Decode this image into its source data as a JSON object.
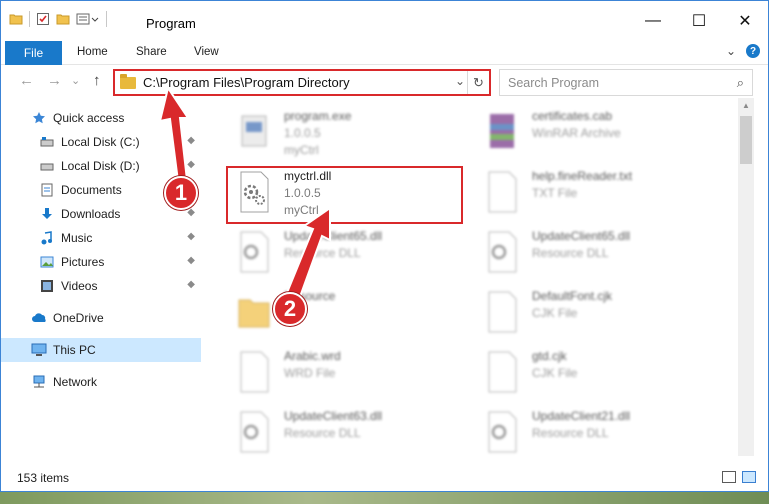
{
  "window": {
    "title": "Program",
    "controls": {
      "minimize": "—",
      "maximize": "☐",
      "close": "✕"
    }
  },
  "ribbon": {
    "tabs": [
      "File",
      "Home",
      "Share",
      "View"
    ],
    "expand": "⌄",
    "help": "?"
  },
  "nav": {
    "back": "←",
    "forward": "→",
    "recent": "⌄",
    "up": "↑",
    "address": "C:\\Program Files\\Program Directory",
    "address_dropdown": "⌄",
    "refresh": "↻",
    "search_placeholder": "Search Program",
    "search_icon": "⌕"
  },
  "sidebar": {
    "items": [
      {
        "label": "Quick access",
        "icon": "star-icon",
        "pinned": false
      },
      {
        "label": "Local Disk (C:)",
        "icon": "drive-icon",
        "pinned": true
      },
      {
        "label": "Local Disk (D:)",
        "icon": "drive-icon",
        "pinned": true
      },
      {
        "label": "Documents",
        "icon": "documents-icon",
        "pinned": true
      },
      {
        "label": "Downloads",
        "icon": "download-icon",
        "pinned": true
      },
      {
        "label": "Music",
        "icon": "music-icon",
        "pinned": true
      },
      {
        "label": "Pictures",
        "icon": "pictures-icon",
        "pinned": true
      },
      {
        "label": "Videos",
        "icon": "videos-icon",
        "pinned": true
      },
      {
        "label": "OneDrive",
        "icon": "cloud-icon",
        "pinned": false
      },
      {
        "label": "This PC",
        "icon": "pc-icon",
        "pinned": false,
        "selected": true
      },
      {
        "label": "Network",
        "icon": "network-icon",
        "pinned": false
      }
    ],
    "pin_glyph": "📌"
  },
  "files": [
    {
      "name": "program.exe",
      "line2": "1.0.0.5",
      "line3": "myCtrl",
      "icon": "exe-icon",
      "blurred": true
    },
    {
      "name": "certificates.cab",
      "line2": "WinRAR Archive",
      "line3": "",
      "icon": "archive-icon",
      "blurred": true
    },
    {
      "name": "myctrl.dll",
      "line2": "1.0.0.5",
      "line3": "myCtrl",
      "icon": "dll-gear-icon",
      "blurred": false
    },
    {
      "name": "help.fineReader.txt",
      "line2": "TXT File",
      "line3": "",
      "icon": "text-file-icon",
      "blurred": true
    },
    {
      "name": "UpdateClient65.dll",
      "line2": "Resource DLL",
      "line3": "",
      "icon": "dll-gear-icon",
      "blurred": true
    },
    {
      "name": "UpdateClient65.dll",
      "line2": "Resource DLL",
      "line3": "",
      "icon": "dll-gear-icon",
      "blurred": true
    },
    {
      "name": "Resource",
      "line2": "",
      "line3": "",
      "icon": "folder-icon",
      "blurred": true
    },
    {
      "name": "DefaultFont.cjk",
      "line2": "CJK File",
      "line3": "",
      "icon": "blank-file-icon",
      "blurred": true
    },
    {
      "name": "Arabic.wrd",
      "line2": "WRD File",
      "line3": "",
      "icon": "blank-file-icon",
      "blurred": true
    },
    {
      "name": "gtd.cjk",
      "line2": "CJK File",
      "line3": "",
      "icon": "blank-file-icon",
      "blurred": true
    },
    {
      "name": "UpdateClient63.dll",
      "line2": "Resource DLL",
      "line3": "",
      "icon": "dll-gear-icon",
      "blurred": true
    },
    {
      "name": "UpdateClient21.dll",
      "line2": "Resource DLL",
      "line3": "",
      "icon": "dll-gear-icon",
      "blurred": true
    }
  ],
  "status": {
    "count": "153 items"
  },
  "annotations": {
    "step1": "1",
    "step2": "2",
    "color": "#d9292b"
  }
}
